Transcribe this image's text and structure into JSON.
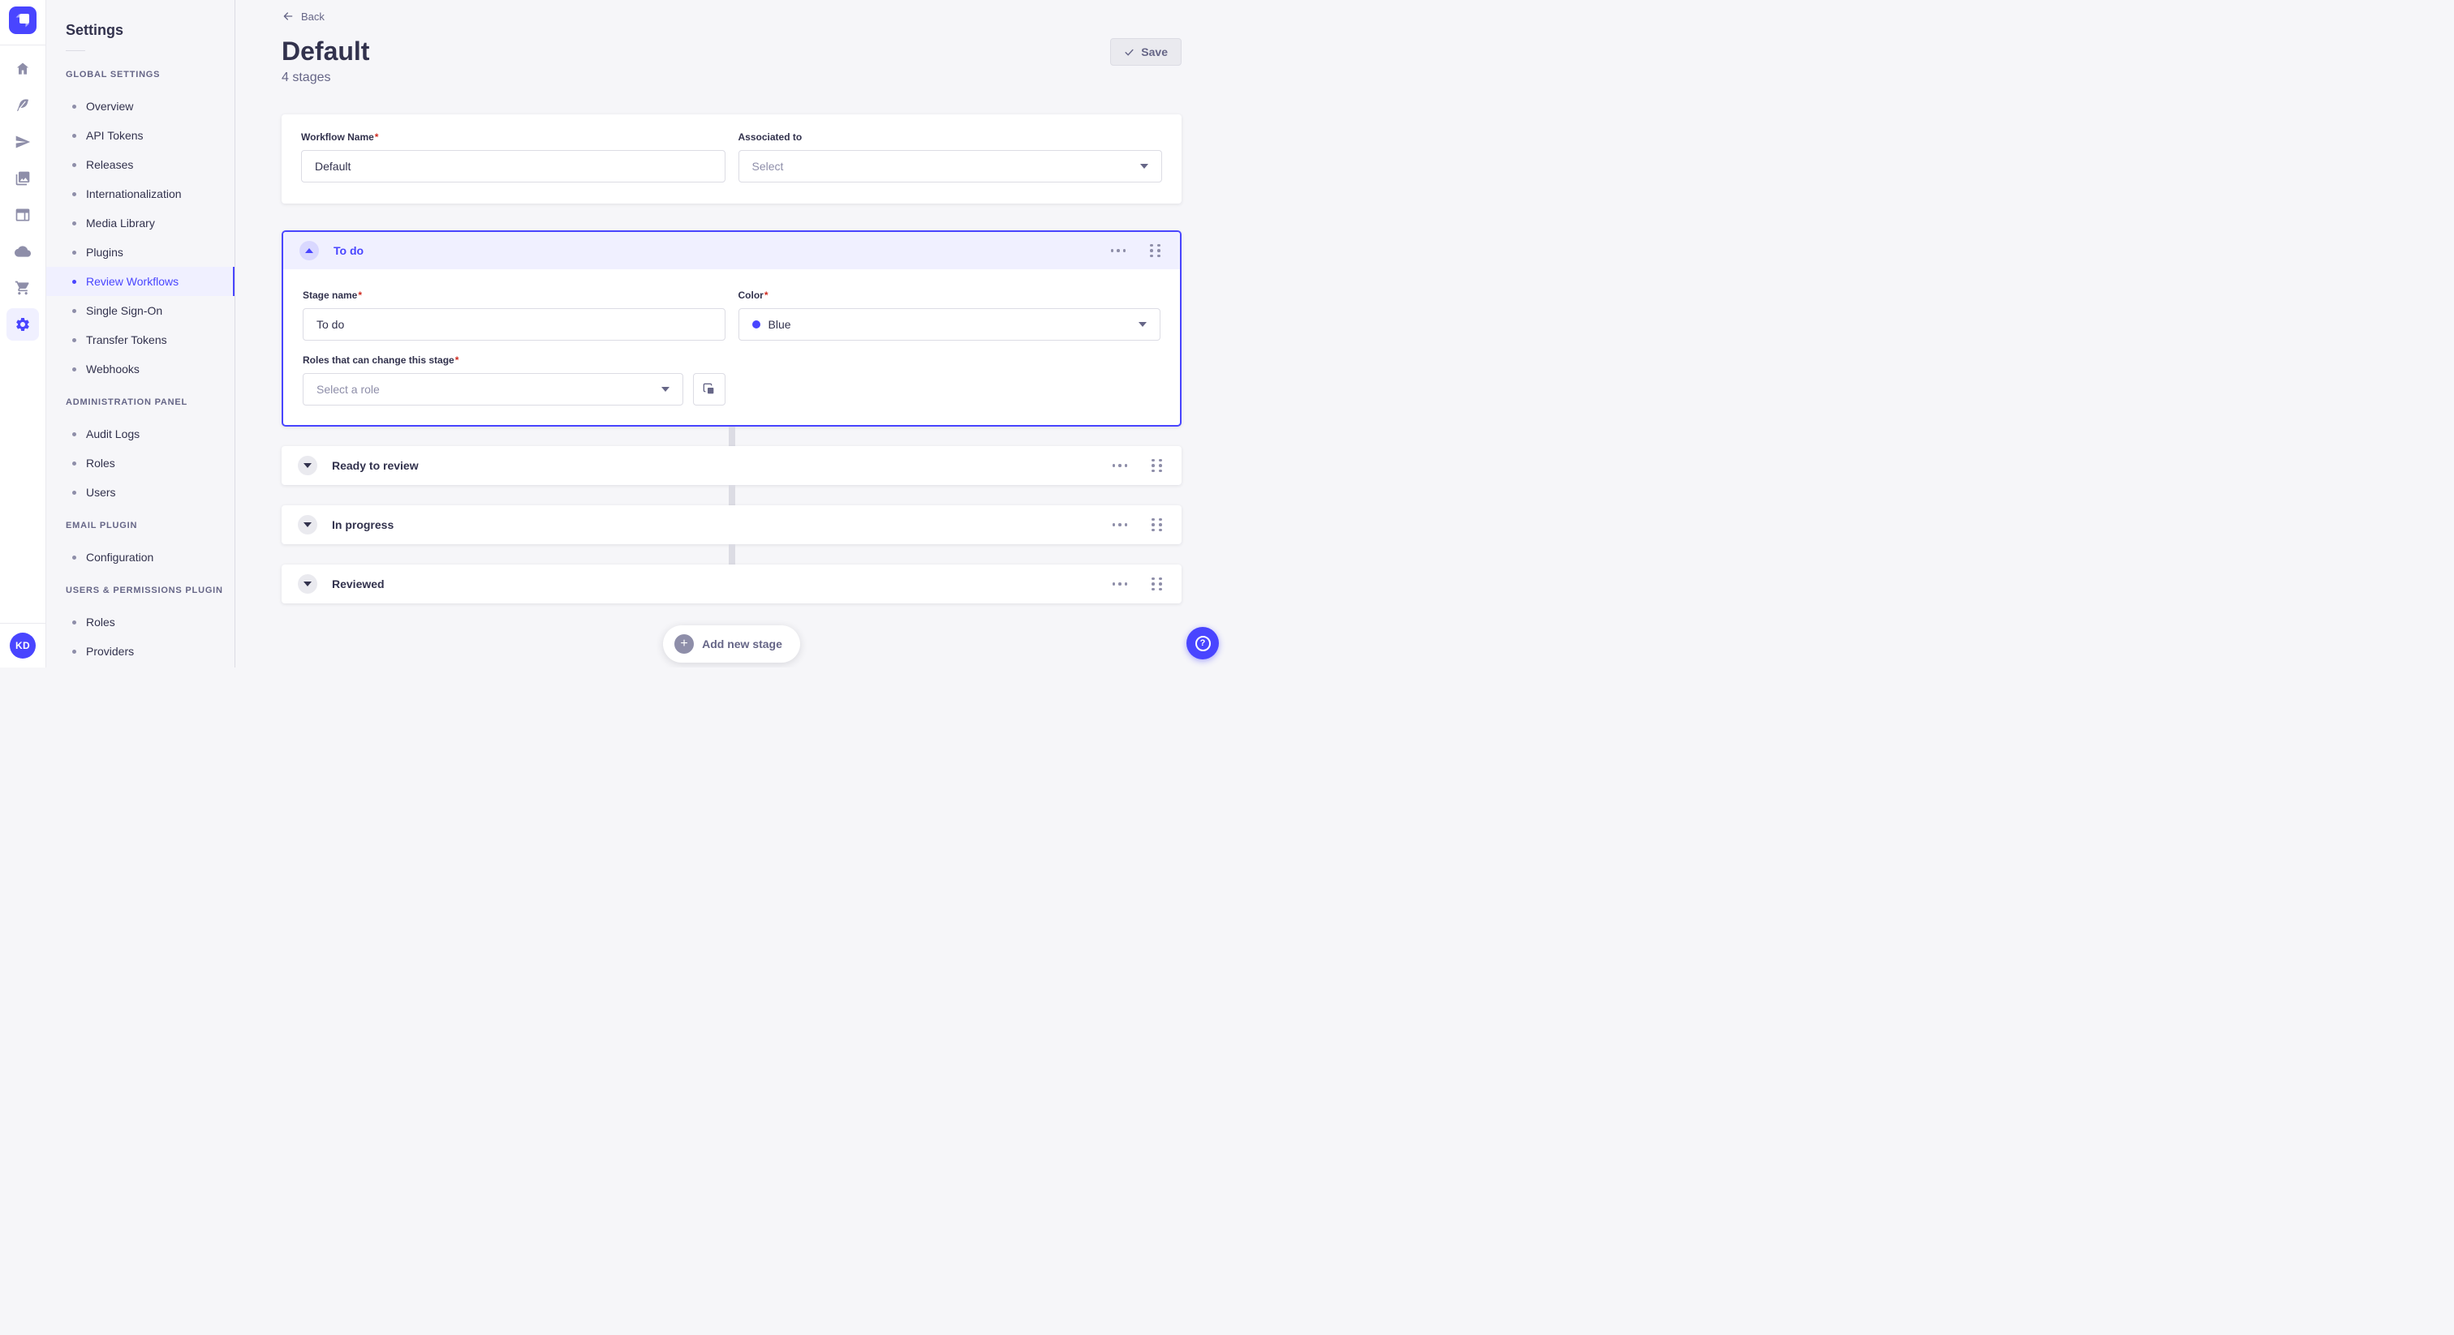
{
  "app": {
    "accent_color": "#4945ff"
  },
  "ui": {
    "required_marker": "*"
  },
  "nav_rail": {
    "logo_icon": "strapi-logo",
    "icons": [
      "home-icon",
      "feather-icon",
      "paper-plane-icon",
      "photos-icon",
      "layout-icon",
      "cloud-icon",
      "cart-icon",
      "gear-icon"
    ],
    "active_icon": "gear-icon",
    "avatar_initials": "KD"
  },
  "sidebar": {
    "title": "Settings",
    "active_item": "Review Workflows",
    "sections": [
      {
        "header": "GLOBAL SETTINGS",
        "items": [
          "Overview",
          "API Tokens",
          "Releases",
          "Internationalization",
          "Media Library",
          "Plugins",
          "Review Workflows",
          "Single Sign-On",
          "Transfer Tokens",
          "Webhooks"
        ]
      },
      {
        "header": "ADMINISTRATION PANEL",
        "items": [
          "Audit Logs",
          "Roles",
          "Users"
        ]
      },
      {
        "header": "EMAIL PLUGIN",
        "items": [
          "Configuration"
        ]
      },
      {
        "header": "USERS & PERMISSIONS PLUGIN",
        "items": [
          "Roles",
          "Providers"
        ]
      }
    ]
  },
  "header": {
    "back_label": "Back",
    "title": "Default",
    "subtitle": "4 stages",
    "save_label": "Save"
  },
  "workflow_form": {
    "name_label": "Workflow Name",
    "name_value": "Default",
    "associated_label": "Associated to",
    "associated_placeholder": "Select"
  },
  "stage_editor": {
    "stage_name_label": "Stage name",
    "stage_name_value": "To do",
    "color_label": "Color",
    "color_value": "Blue",
    "color_dot_hex": "#4945ff",
    "roles_label": "Roles that can change this stage",
    "roles_placeholder": "Select a role"
  },
  "stages": [
    {
      "name": "To do",
      "expanded": true
    },
    {
      "name": "Ready to review",
      "expanded": false
    },
    {
      "name": "In progress",
      "expanded": false
    },
    {
      "name": "Reviewed",
      "expanded": false
    }
  ],
  "footer": {
    "add_stage_label": "Add new stage",
    "help_icon": "question-mark-icon"
  }
}
